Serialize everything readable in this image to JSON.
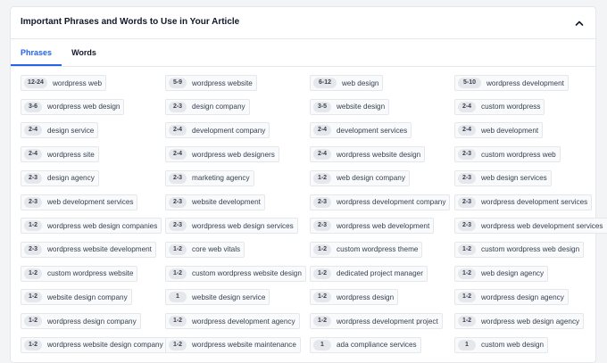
{
  "panel": {
    "title": "Important Phrases and Words to Use in Your Article",
    "tabs": [
      {
        "label": "Phrases",
        "active": true
      },
      {
        "label": "Words",
        "active": false
      }
    ]
  },
  "colors": {
    "accent": "#2563eb",
    "chip_bg": "#f9fafb",
    "count_bg": "#e5e7eb"
  },
  "phrases": [
    [
      {
        "count": "12-24",
        "text": "wordpress web"
      },
      {
        "count": "5-9",
        "text": "wordpress website"
      },
      {
        "count": "6-12",
        "text": "web design"
      },
      {
        "count": "5-10",
        "text": "wordpress development"
      }
    ],
    [
      {
        "count": "3-6",
        "text": "wordpress web design"
      },
      {
        "count": "2-3",
        "text": "design company"
      },
      {
        "count": "3-5",
        "text": "website design"
      },
      {
        "count": "2-4",
        "text": "custom wordpress"
      }
    ],
    [
      {
        "count": "2-4",
        "text": "design service"
      },
      {
        "count": "2-4",
        "text": "development company"
      },
      {
        "count": "2-4",
        "text": "development services"
      },
      {
        "count": "2-4",
        "text": "web development"
      }
    ],
    [
      {
        "count": "2-4",
        "text": "wordpress site"
      },
      {
        "count": "2-4",
        "text": "wordpress web designers"
      },
      {
        "count": "2-4",
        "text": "wordpress website design"
      },
      {
        "count": "2-3",
        "text": "custom wordpress web"
      }
    ],
    [
      {
        "count": "2-3",
        "text": "design agency"
      },
      {
        "count": "2-3",
        "text": "marketing agency"
      },
      {
        "count": "1-2",
        "text": "web design company"
      },
      {
        "count": "2-3",
        "text": "web design services"
      }
    ],
    [
      {
        "count": "2-3",
        "text": "web development services"
      },
      {
        "count": "2-3",
        "text": "website development"
      },
      {
        "count": "2-3",
        "text": "wordpress development company"
      },
      {
        "count": "2-3",
        "text": "wordpress development services"
      }
    ],
    [
      {
        "count": "1-2",
        "text": "wordpress web design companies"
      },
      {
        "count": "2-3",
        "text": "wordpress web design services"
      },
      {
        "count": "2-3",
        "text": "wordpress web development"
      },
      {
        "count": "2-3",
        "text": "wordpress web development services"
      }
    ],
    [
      {
        "count": "2-3",
        "text": "wordpress website development"
      },
      {
        "count": "1-2",
        "text": "core web vitals"
      },
      {
        "count": "1-2",
        "text": "custom wordpress theme"
      },
      {
        "count": "1-2",
        "text": "custom wordpress web design"
      }
    ],
    [
      {
        "count": "1-2",
        "text": "custom wordpress website"
      },
      {
        "count": "1-2",
        "text": "custom wordpress website design"
      },
      {
        "count": "1-2",
        "text": "dedicated project manager"
      },
      {
        "count": "1-2",
        "text": "web design agency"
      }
    ],
    [
      {
        "count": "1-2",
        "text": "website design company"
      },
      {
        "count": "1",
        "text": "website design service"
      },
      {
        "count": "1-2",
        "text": "wordpress design"
      },
      {
        "count": "1-2",
        "text": "wordpress design agency"
      }
    ],
    [
      {
        "count": "1-2",
        "text": "wordpress design company"
      },
      {
        "count": "1-2",
        "text": "wordpress development agency"
      },
      {
        "count": "1-2",
        "text": "wordpress development project"
      },
      {
        "count": "1-2",
        "text": "wordpress web design agency"
      }
    ],
    [
      {
        "count": "1-2",
        "text": "wordpress website design company"
      },
      {
        "count": "1-2",
        "text": "wordpress website maintenance"
      },
      {
        "count": "1",
        "text": "ada compliance services"
      },
      {
        "count": "1",
        "text": "custom web design"
      }
    ]
  ]
}
